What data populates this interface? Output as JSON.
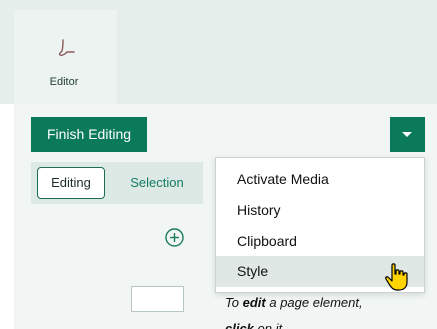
{
  "ribbon": {
    "editor_tab": {
      "label": "Editor",
      "icon": "editor-pen-icon"
    }
  },
  "toolbar": {
    "finish_label": "Finish Editing",
    "dropdown_icon": "caret-down-icon",
    "accent_color": "#0b7a5a"
  },
  "mode_toggle": {
    "editing_label": "Editing",
    "selection_label": "Selection",
    "active": "Editing"
  },
  "canvas": {
    "add_icon": "add-circle-icon",
    "hint": {
      "to": "To",
      "edit": "edit",
      "middle": "a page element,",
      "click": "click",
      "end": "on it."
    }
  },
  "menu": {
    "items": [
      {
        "label": "Activate Media"
      },
      {
        "label": "History"
      },
      {
        "label": "Clipboard"
      },
      {
        "label": "Style",
        "hovered": true
      }
    ]
  },
  "cursor": {
    "icon": "hand-pointer-icon"
  }
}
